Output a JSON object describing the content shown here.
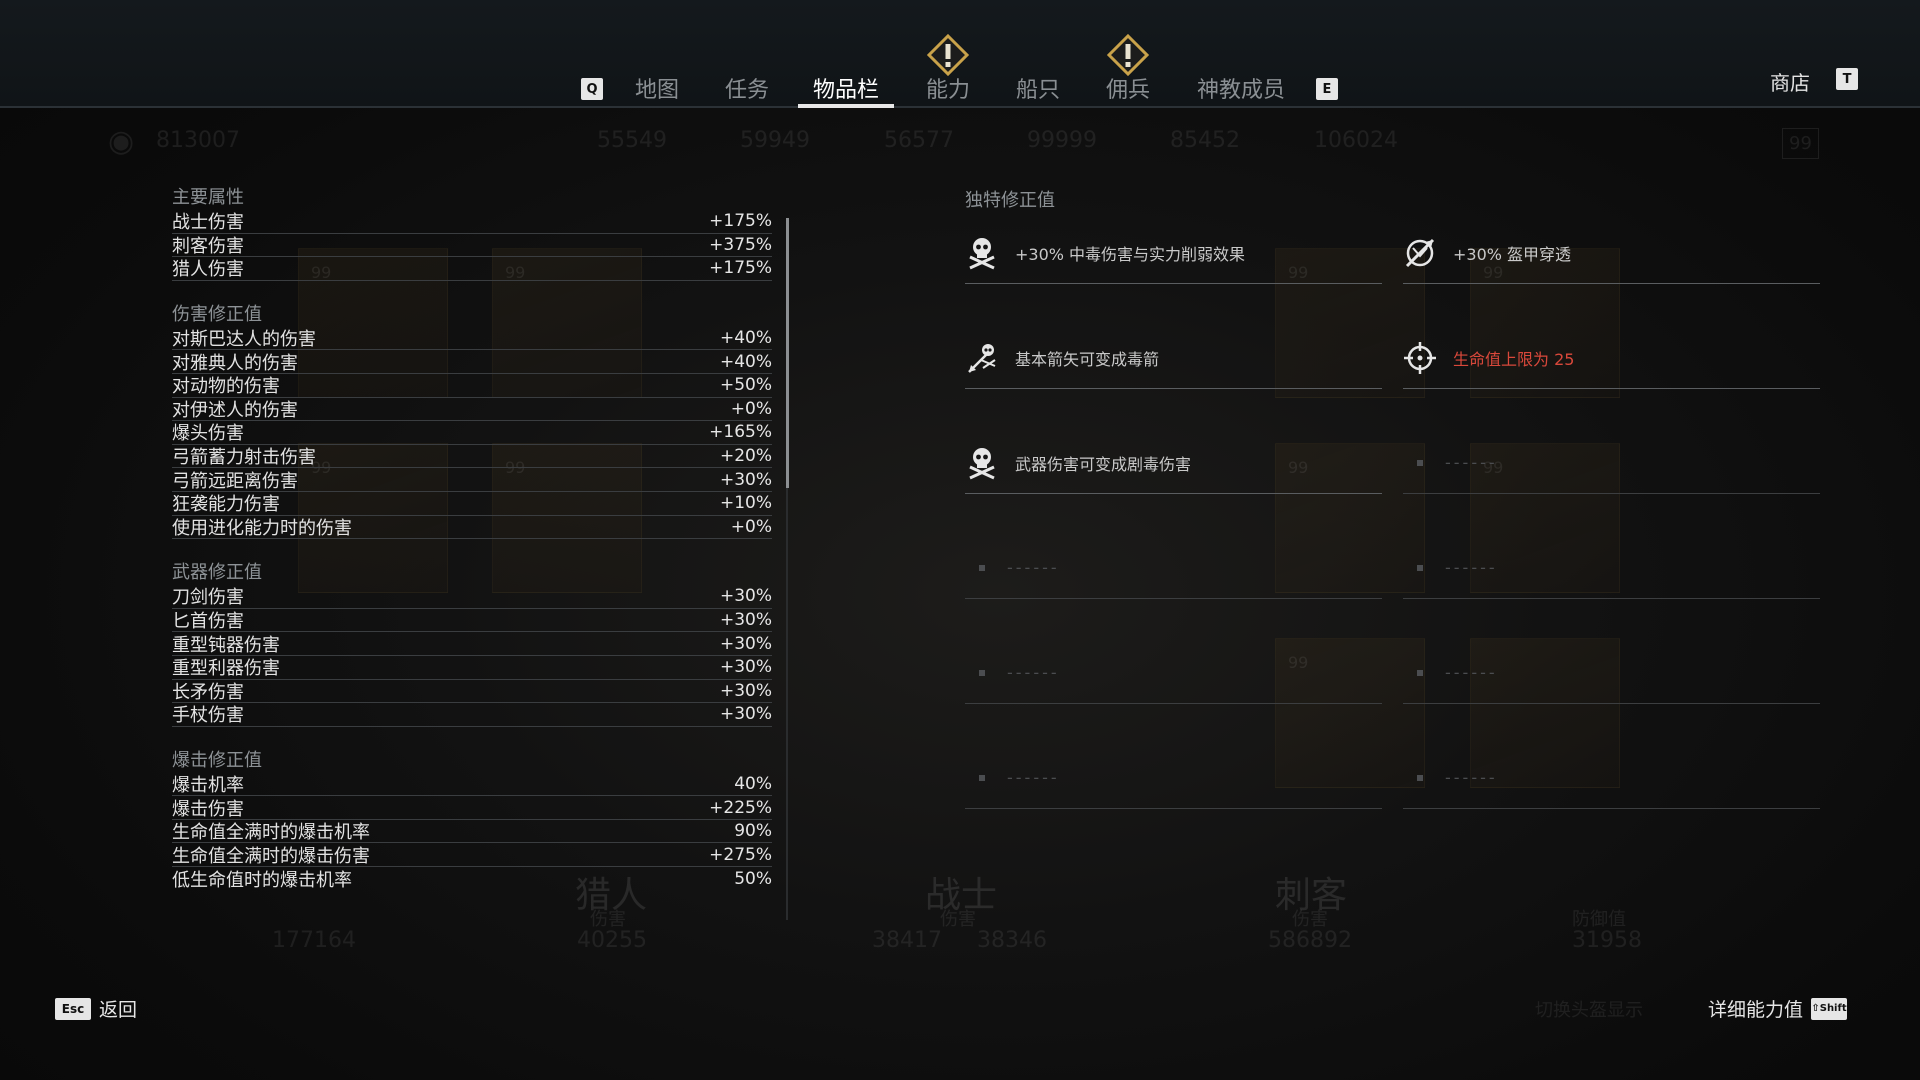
{
  "nav": {
    "prev_key": "Q",
    "next_key": "E",
    "tabs": [
      {
        "label": "地图"
      },
      {
        "label": "任务"
      },
      {
        "label": "物品栏"
      },
      {
        "label": "能力"
      },
      {
        "label": "船只"
      },
      {
        "label": "佣兵"
      },
      {
        "label": "神教成员"
      }
    ],
    "active_tab": "物品栏",
    "shop_label": "商店",
    "shop_key": "T"
  },
  "background": {
    "currency": "813007",
    "resources": [
      "55549",
      "59949",
      "56577",
      "99999",
      "85452",
      "106024"
    ],
    "level_badge": "99",
    "card_level": "99",
    "hunter_label": "猎人",
    "warrior_label": "战士",
    "assassin_label": "刺客",
    "damage_label": "伤害",
    "armor_label": "防御值",
    "health_value": "177164",
    "hunter_damage": "40255",
    "warrior_damage_a": "38417",
    "warrior_damage_b": "38346",
    "assassin_damage": "586892",
    "armor_value": "31958",
    "helmet_toggle": "切换头盔显示"
  },
  "stats": {
    "main": {
      "title": "主要属性",
      "rows": [
        {
          "label": "战士伤害",
          "value": "+175%"
        },
        {
          "label": "刺客伤害",
          "value": "+375%"
        },
        {
          "label": "猎人伤害",
          "value": "+175%"
        }
      ]
    },
    "damage": {
      "title": "伤害修正值",
      "rows": [
        {
          "label": "对斯巴达人的伤害",
          "value": "+40%"
        },
        {
          "label": "对雅典人的伤害",
          "value": "+40%"
        },
        {
          "label": "对动物的伤害",
          "value": "+50%"
        },
        {
          "label": "对伊述人的伤害",
          "value": "+0%"
        },
        {
          "label": "爆头伤害",
          "value": "+165%"
        },
        {
          "label": "弓箭蓄力射击伤害",
          "value": "+20%"
        },
        {
          "label": "弓箭远距离伤害",
          "value": "+30%"
        },
        {
          "label": "狂袭能力伤害",
          "value": "+10%"
        },
        {
          "label": "使用进化能力时的伤害",
          "value": "+0%"
        }
      ]
    },
    "weapon": {
      "title": "武器修正值",
      "rows": [
        {
          "label": "刀剑伤害",
          "value": "+30%"
        },
        {
          "label": "匕首伤害",
          "value": "+30%"
        },
        {
          "label": "重型钝器伤害",
          "value": "+30%"
        },
        {
          "label": "重型利器伤害",
          "value": "+30%"
        },
        {
          "label": "长矛伤害",
          "value": "+30%"
        },
        {
          "label": "手杖伤害",
          "value": "+30%"
        }
      ]
    },
    "crit": {
      "title": "爆击修正值",
      "rows": [
        {
          "label": "爆击机率",
          "value": "40%"
        },
        {
          "label": "爆击伤害",
          "value": "+225%"
        },
        {
          "label": "生命值全满时的爆击机率",
          "value": "90%"
        },
        {
          "label": "生命值全满时的爆击伤害",
          "value": "+275%"
        },
        {
          "label": "低生命值时的爆击机率",
          "value": "50%"
        }
      ]
    }
  },
  "unique": {
    "title": "独特修正值",
    "items": [
      {
        "icon": "skull-crossbones-icon",
        "text": "+30% 中毒伤害与实力削弱效果",
        "red": false
      },
      {
        "icon": "armor-pierce-icon",
        "text": "+30% 盔甲穿透",
        "red": false
      },
      {
        "icon": "poison-arrow-icon",
        "text": "基本箭矢可变成毒箭",
        "red": false
      },
      {
        "icon": "crosshair-icon",
        "text": "生命值上限为 25",
        "red": true
      },
      {
        "icon": "skull-crossbones-icon",
        "text": "武器伤害可变成剧毒伤害",
        "red": false
      }
    ],
    "empty_text": "------"
  },
  "footer": {
    "back_key": "Esc",
    "back_label": "返回",
    "details_label": "详细能力值",
    "details_key": "⇧Shift"
  },
  "colors": {
    "accent_red": "#d9483b",
    "warn_gold": "#c9a24a"
  }
}
